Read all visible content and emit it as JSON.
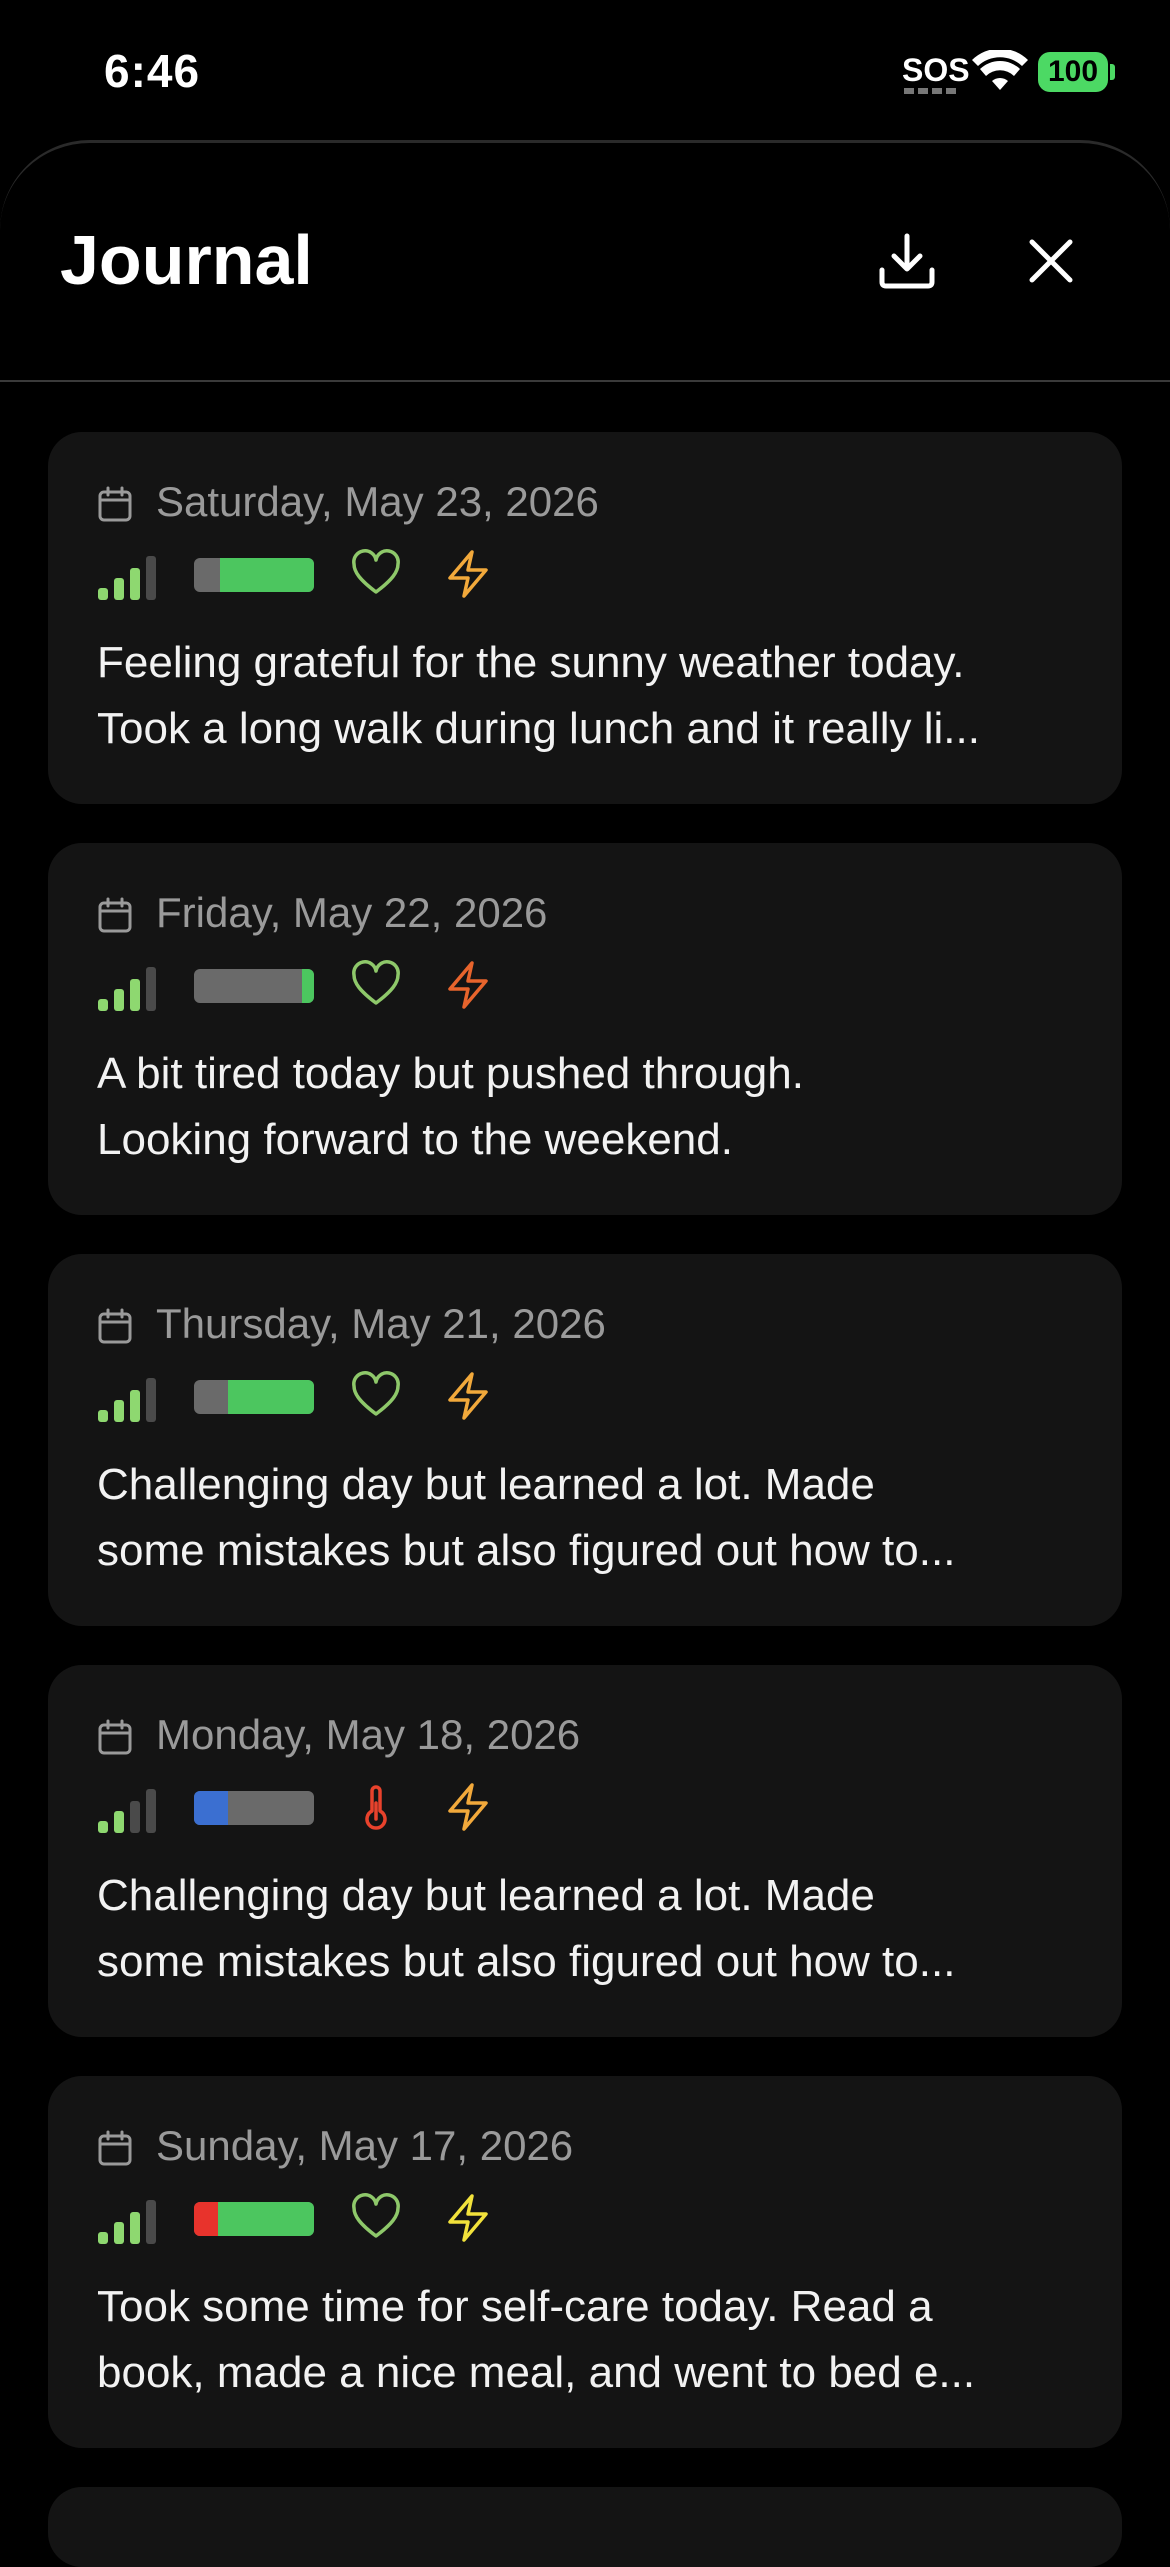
{
  "status_bar": {
    "time": "6:46",
    "sos": "SOS",
    "battery": "100"
  },
  "header": {
    "title": "Journal"
  },
  "entries": [
    {
      "date": "Saturday, May 23, 2026",
      "lines": [
        "Feeling grateful for the sunny weather today.",
        "Took a long walk during lunch and it really li..."
      ],
      "signal_level": 3,
      "bar": {
        "accent_color": "#4cc65f",
        "accent_start": 0.22,
        "accent_end": 1.0
      },
      "mood_icon": "heart-icon",
      "mood_color": "#8ec86a",
      "energy_color": "#f2a93b"
    },
    {
      "date": "Friday, May 22, 2026",
      "lines": [
        "A bit tired today but pushed through.",
        "Looking forward to the weekend."
      ],
      "signal_level": 3,
      "bar": {
        "accent_color": "#4cc65f",
        "accent_start": 0.9,
        "accent_end": 1.0
      },
      "mood_icon": "heart-icon",
      "mood_color": "#8ec86a",
      "energy_color": "#e8642c"
    },
    {
      "date": "Thursday, May 21, 2026",
      "lines": [
        "Challenging day but learned a lot. Made",
        "some mistakes but also figured out how to..."
      ],
      "signal_level": 3,
      "bar": {
        "accent_color": "#4cc65f",
        "accent_start": 0.28,
        "accent_end": 1.0
      },
      "mood_icon": "heart-icon",
      "mood_color": "#8ec86a",
      "energy_color": "#f2a93b"
    },
    {
      "date": "Monday, May 18, 2026",
      "lines": [
        "Challenging day but learned a lot. Made",
        "some mistakes but also figured out how to..."
      ],
      "signal_level": 2,
      "bar": {
        "accent_color": "#3b6fd1",
        "accent_start": 0.0,
        "accent_end": 0.28
      },
      "mood_icon": "thermometer-icon",
      "mood_color": "#e8422c",
      "energy_color": "#f2a93b"
    },
    {
      "date": "Sunday, May 17, 2026",
      "lines": [
        "Took some time for self-care today. Read a",
        "book, made a nice meal, and went to bed e..."
      ],
      "signal_level": 3,
      "bar": {
        "accent_color": "#4cc65f",
        "accent_start": 0.2,
        "accent_end": 1.0,
        "left_color": "#e8332c"
      },
      "mood_icon": "heart-icon",
      "mood_color": "#8ec86a",
      "energy_color": "#f2e23b"
    }
  ]
}
